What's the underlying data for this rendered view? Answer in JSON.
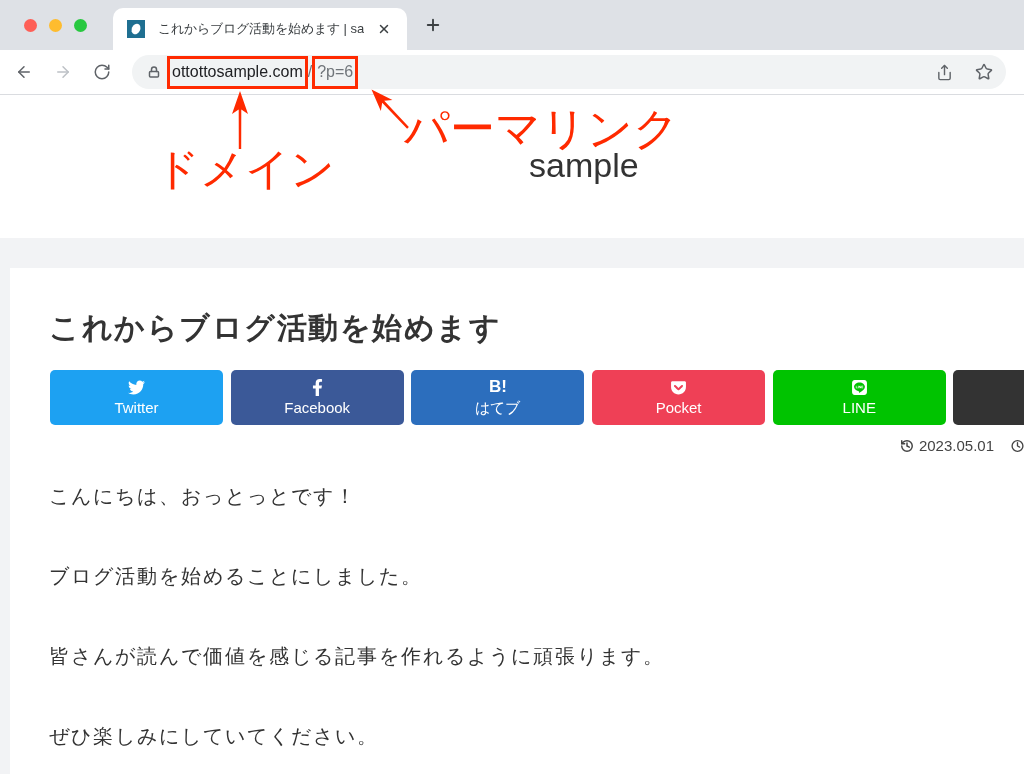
{
  "browser": {
    "tab": {
      "title": "これからブログ活動を始めます | sa",
      "selected": true
    },
    "nav": [
      {
        "kind": "back",
        "disabled": false
      },
      {
        "kind": "forward",
        "disabled": true
      },
      {
        "kind": "reload",
        "disabled": false
      }
    ],
    "address_bar": {
      "segments": [
        {
          "kind": "host",
          "text": "ottottosample.com",
          "highlighted": true
        },
        {
          "kind": "path",
          "text": "/",
          "highlighted": false
        },
        {
          "kind": "path",
          "text": "?p=6",
          "highlighted": true
        }
      ]
    }
  },
  "annotations": [
    {
      "label": "ドメイン"
    },
    {
      "label": "パーマリンク"
    }
  ],
  "site": {
    "title": "sample"
  },
  "article": {
    "title": "これからブログ活動を始めます",
    "share_buttons": [
      {
        "kind": "twitter",
        "label": "Twitter",
        "color": "#1da1f2"
      },
      {
        "kind": "facebook",
        "label": "Facebook",
        "color": "#3b5998"
      },
      {
        "kind": "hatena",
        "icon_text": "B!",
        "label": "はてブ",
        "color": "#2c6ebd"
      },
      {
        "kind": "pocket",
        "label": "Pocket",
        "color": "#ef4056"
      },
      {
        "kind": "line",
        "label": "LINE",
        "color": "#00c300"
      },
      {
        "kind": "partial",
        "color": "#333333"
      }
    ],
    "updated": "2023.05.01",
    "paragraphs": [
      "こんにちは、おっとっとです！",
      "ブログ活動を始めることにしました。",
      "皆さんが読んで価値を感じる記事を作れるように頑張ります。",
      "ぜひ楽しみにしていてください。"
    ]
  }
}
